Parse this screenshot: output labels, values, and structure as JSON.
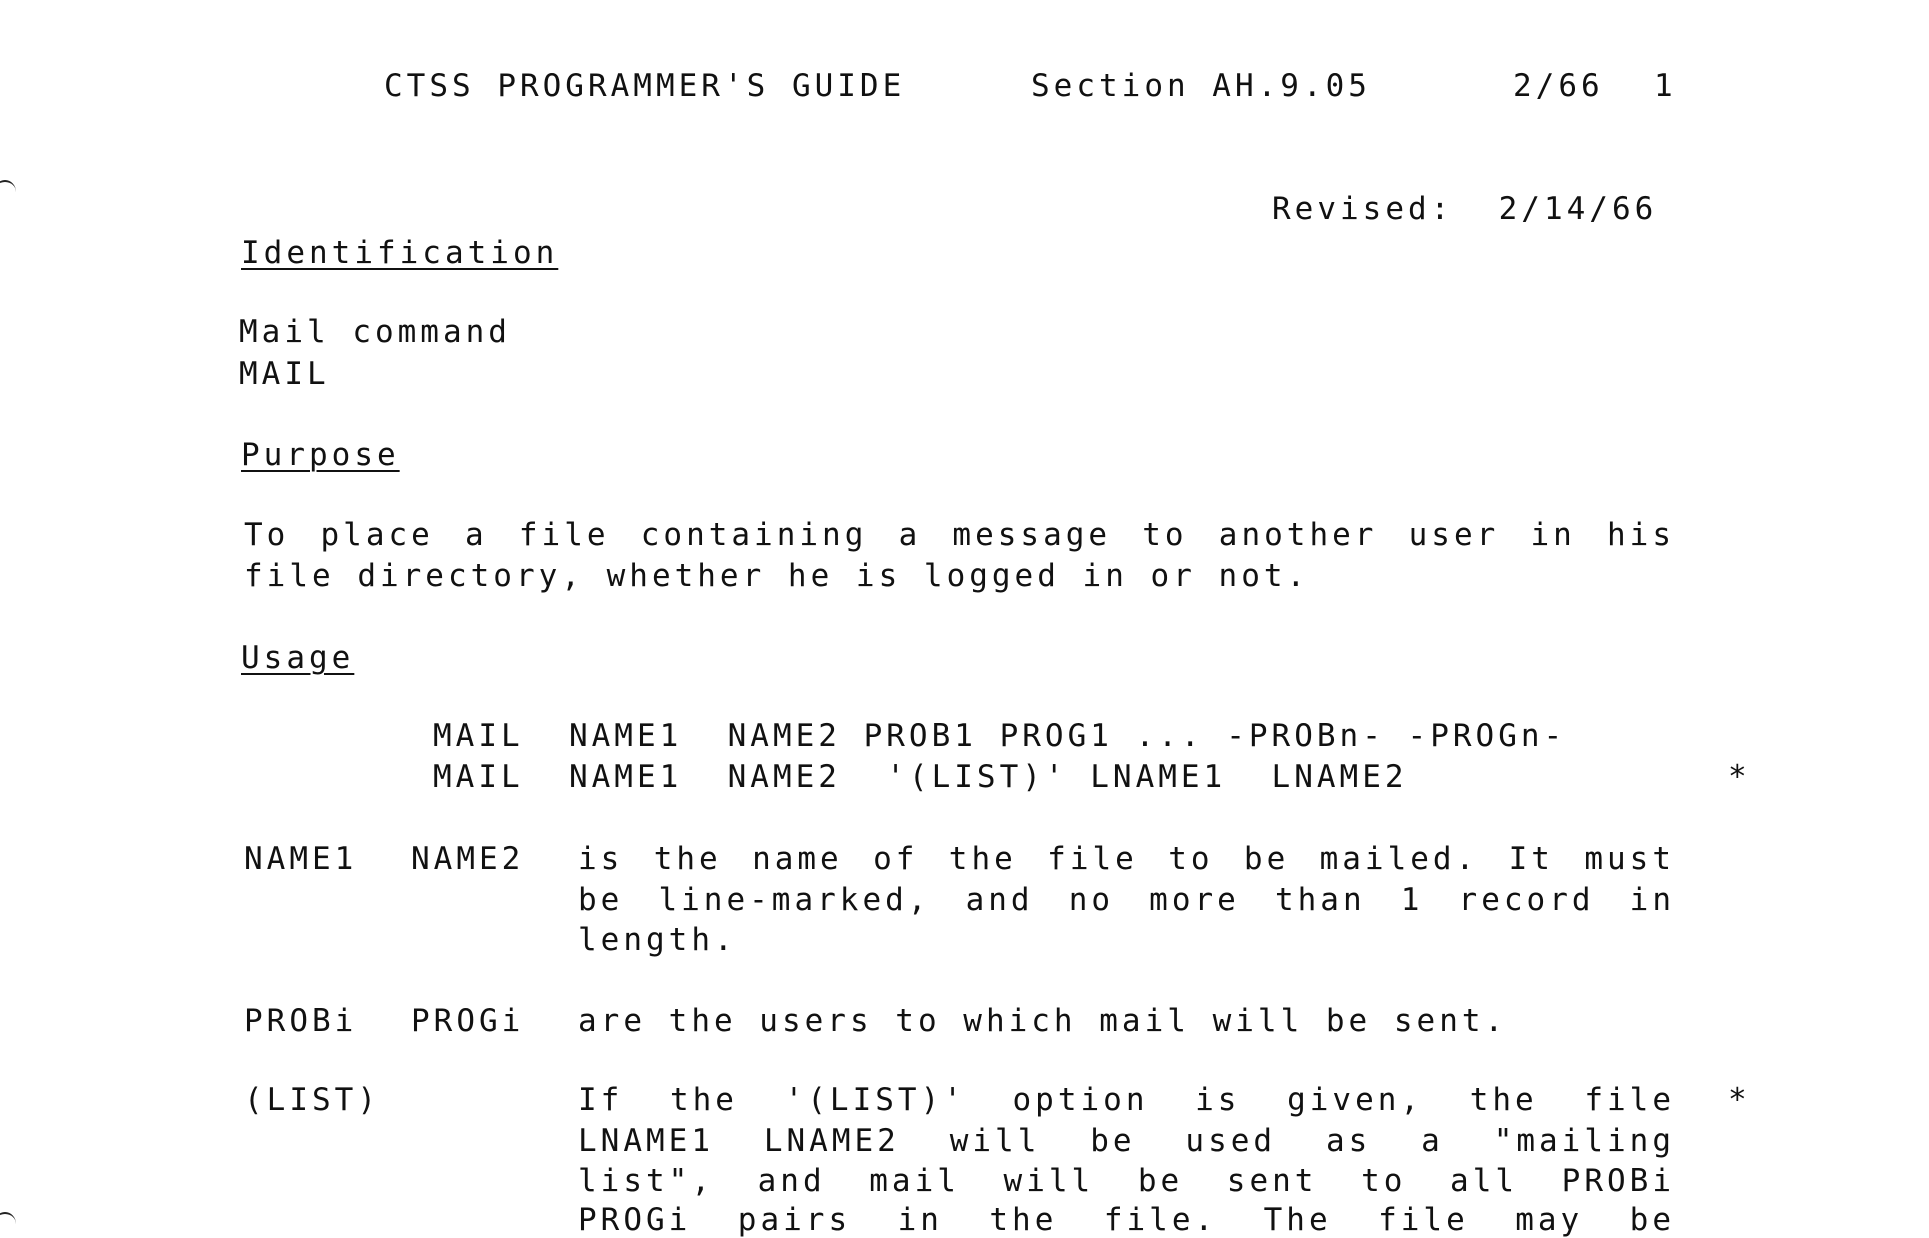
{
  "header": {
    "title": "CTSS PROGRAMMER'S GUIDE",
    "section": "Section AH.9.05",
    "date": "2/66",
    "page": "1"
  },
  "revised": "Revised:  2/14/66",
  "identification": {
    "heading": "Identification",
    "lines": [
      "Mail command",
      "MAIL"
    ]
  },
  "purpose": {
    "heading": "Purpose",
    "lines": [
      "To place a file containing a message to another user in  his",
      "file directory, whether he is logged in or not."
    ]
  },
  "usage": {
    "heading": "Usage",
    "syntax": [
      "MAIL  NAME1  NAME2 PROB1 PROG1 ... -PROBn- -PROGn-",
      "MAIL  NAME1  NAME2  '(LIST)' LNAME1  LNAME2"
    ],
    "change_mark": "*",
    "params": [
      {
        "name1": "NAME1",
        "name2": "NAME2",
        "lines": [
          "is the name of the file to be mailed.  It must",
          "be line-marked, and no more than 1  record  in",
          "length."
        ]
      },
      {
        "name1": "PROBi",
        "name2": "PROGi",
        "lines": [
          "are the users to which mail will be sent."
        ]
      },
      {
        "name1": "(LIST)",
        "name2": "",
        "lines": [
          "If the '(LIST)' option is given, the file",
          "LNAME1 LNAME2 will be used as a \"mailing",
          "list\", and mail will be sent to all PROBi",
          "PROGi pairs in the file.  The file may be"
        ],
        "change_mark": "*"
      }
    ]
  }
}
